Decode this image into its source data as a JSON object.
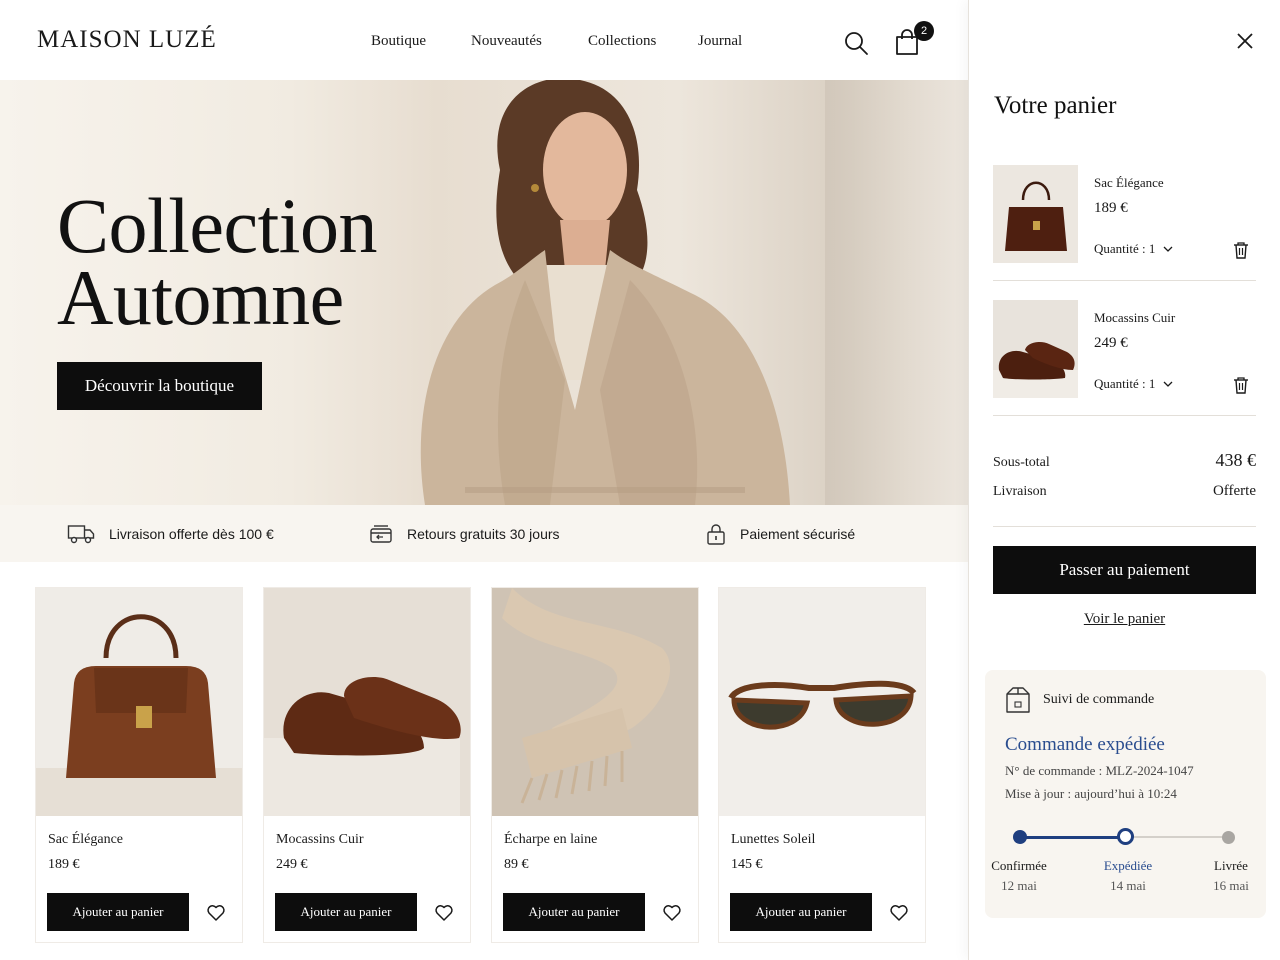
{
  "header": {
    "logo": "MAISON LUZÉ",
    "nav": [
      "Boutique",
      "Nouveautés",
      "Collections",
      "Journal"
    ],
    "cart_count": "2",
    "icons": [
      "search-icon",
      "shopping-bag-icon"
    ]
  },
  "hero": {
    "title_line1": "Collection",
    "title_line2": "Automne",
    "cta": "Découvrir la boutique"
  },
  "benefits": [
    {
      "icon": "truck-icon",
      "label": "Livraison offerte dès 100 €"
    },
    {
      "icon": "return-box-icon",
      "label": "Retours gratuits 30 jours"
    },
    {
      "icon": "lock-icon",
      "label": "Paiement sécurisé"
    }
  ],
  "products": [
    {
      "name": "Sac Élégance",
      "price": "189 €",
      "add_label": "Ajouter au panier"
    },
    {
      "name": "Mocassins Cuir",
      "price": "249 €",
      "add_label": "Ajouter au panier"
    },
    {
      "name": "Écharpe en laine",
      "price": "89 €",
      "add_label": "Ajouter au panier"
    },
    {
      "name": "Lunettes Soleil",
      "price": "145 €",
      "add_label": "Ajouter au panier"
    }
  ],
  "cart": {
    "title": "Votre panier",
    "items": [
      {
        "name": "Sac Élégance",
        "price": "189 €",
        "quantity_label": "Quantité : 1"
      },
      {
        "name": "Mocassins Cuir",
        "price": "249 €",
        "quantity_label": "Quantité : 1"
      }
    ],
    "subtotal_label": "Sous-total",
    "subtotal_value": "438 €",
    "shipping_label": "Livraison",
    "shipping_value": "Offerte",
    "checkout_label": "Passer au paiement",
    "view_cart_label": "Voir le panier"
  },
  "tracking": {
    "heading": "Suivi de commande",
    "status": "Commande expédiée",
    "order_number": "N° de commande : MLZ-2024-1047",
    "updated": "Mise à jour : aujourd’hui à 10:24",
    "steps": [
      {
        "label": "Confirmée",
        "date": "12 mai"
      },
      {
        "label": "Expédiée",
        "date": "14 mai"
      },
      {
        "label": "Livrée",
        "date": "16 mai"
      }
    ],
    "colors": {
      "active": "#1f3f80",
      "inactive": "#a9a6a2"
    }
  }
}
